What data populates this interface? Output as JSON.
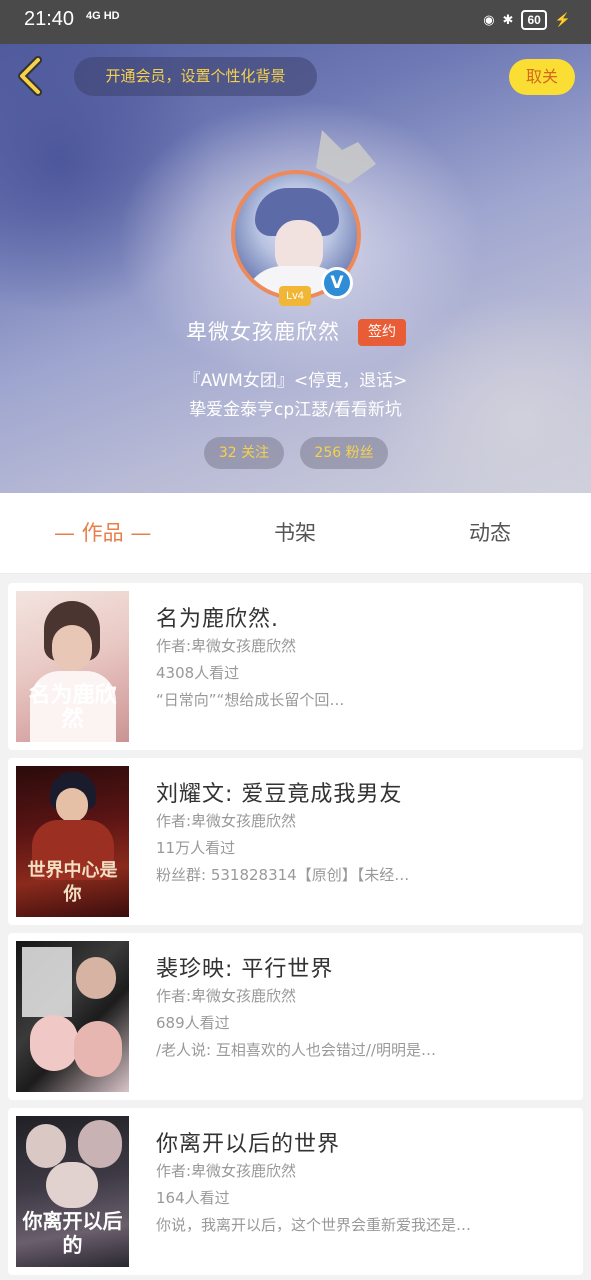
{
  "status_bar": {
    "time": "21:40",
    "network": "4G HD",
    "battery": "60"
  },
  "header": {
    "vip_banner": "开通会员，设置个性化背景",
    "unfollow_label": "取关",
    "level": "Lv4",
    "username": "卑微女孩鹿欣然",
    "signed_badge": "签约",
    "bio_line1": "『AWM女团』<停更，退话>",
    "bio_line2": "挚爱金泰亨cp江瑟/看看新坑",
    "following": "32 关注",
    "fans": "256 粉丝"
  },
  "tabs": {
    "works": "— 作品 —",
    "bookshelf": "书架",
    "feed": "动态"
  },
  "books": [
    {
      "title": "名为鹿欣然.",
      "author": "作者:卑微女孩鹿欣然",
      "views": "4308人看过",
      "desc": "“日常向”“想给成长留个回…",
      "cover_text": "名为鹿欣然"
    },
    {
      "title": "刘耀文: 爱豆竟成我男友",
      "author": "作者:卑微女孩鹿欣然",
      "views": "11万人看过",
      "desc": "粉丝群: 531828314【原创】【未经…",
      "cover_text": "世界中心是你"
    },
    {
      "title": "裴珍映: 平行世界",
      "author": "作者:卑微女孩鹿欣然",
      "views": "689人看过",
      "desc": "/老人说: 互相喜欢的人也会错过//明明是…",
      "cover_text": ""
    },
    {
      "title": "你离开以后的世界",
      "author": "作者:卑微女孩鹿欣然",
      "views": "164人看过",
      "desc": "你说，我离开以后，这个世界会重新爱我还是…",
      "cover_text": "你离开以后的"
    }
  ]
}
